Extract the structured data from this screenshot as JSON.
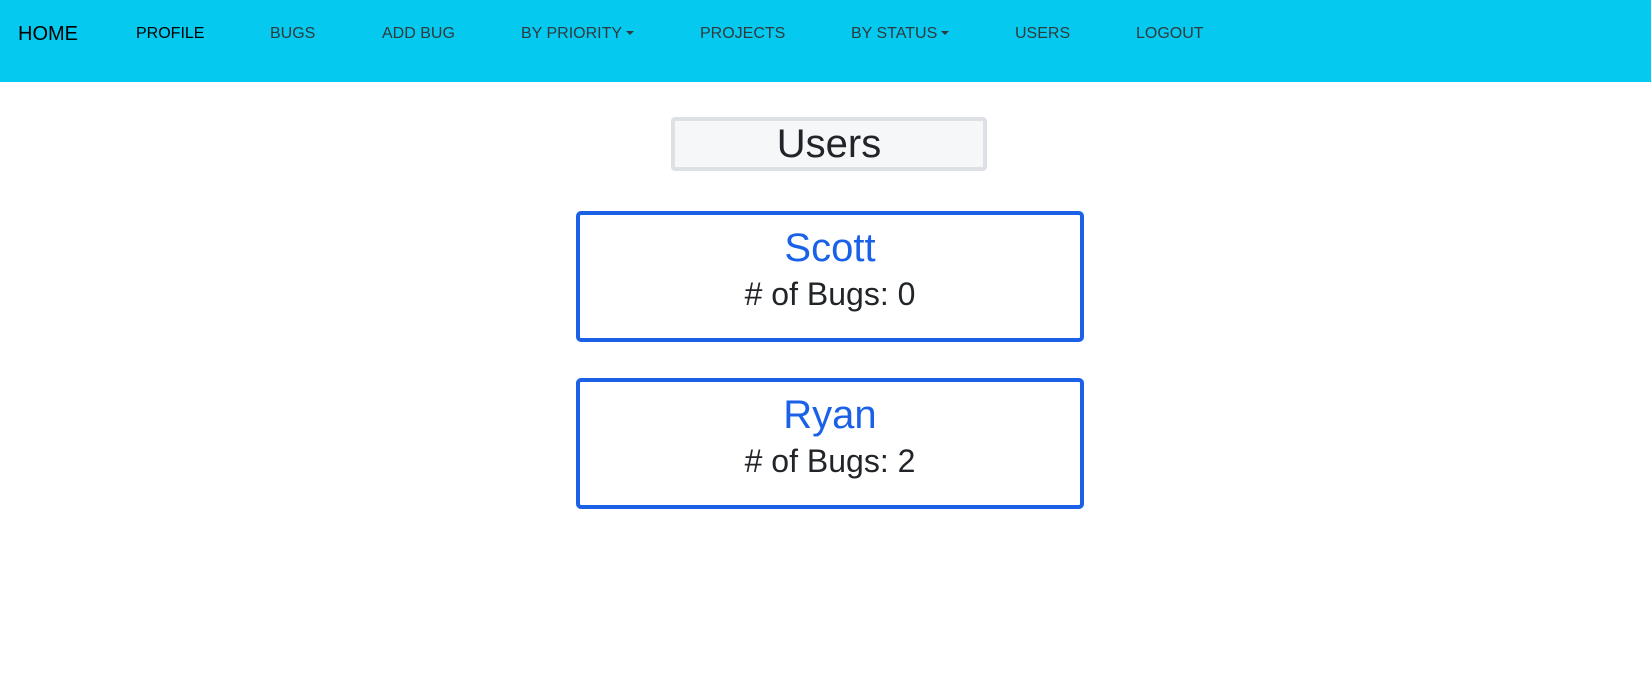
{
  "navbar": {
    "brand": "HOME",
    "items": [
      {
        "label": "PROFILE"
      },
      {
        "label": "BUGS"
      },
      {
        "label": "ADD BUG"
      },
      {
        "label": "BY PRIORITY"
      },
      {
        "label": "PROJECTS"
      },
      {
        "label": "BY STATUS"
      },
      {
        "label": "USERS"
      },
      {
        "label": "LOGOUT"
      }
    ]
  },
  "page": {
    "title": "Users"
  },
  "users": [
    {
      "name": "Scott",
      "bugs_label": "# of Bugs: 0"
    },
    {
      "name": "Ryan",
      "bugs_label": "# of Bugs: 2"
    }
  ],
  "colors": {
    "navbar_bg": "#05c9ef",
    "card_border": "#1a61e8",
    "user_name": "#1a61e8"
  }
}
